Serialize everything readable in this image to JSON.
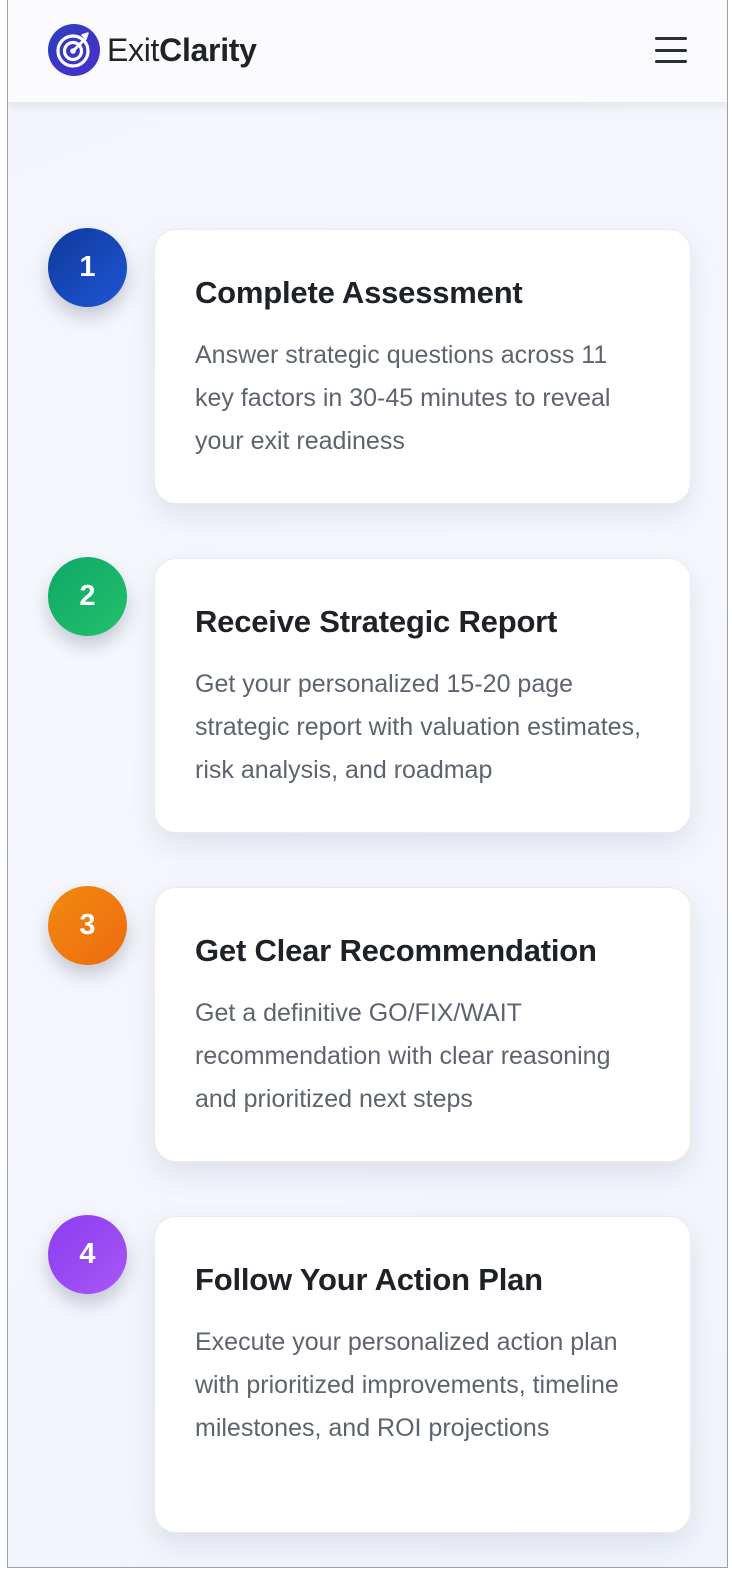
{
  "header": {
    "brand_part1": "Exit",
    "brand_part2": "Clarity",
    "logo_icon": "target-arrow-icon",
    "menu_icon": "hamburger-menu-icon"
  },
  "steps": [
    {
      "number": "1",
      "title": "Complete Assessment",
      "description": "Answer strategic questions across 11 key factors in 30-45 minutes to reveal your exit readiness",
      "color": "#1746c2"
    },
    {
      "number": "2",
      "title": "Receive Strategic Report",
      "description": "Get your personalized 15-20 page strategic report with valuation estimates, risk analysis, and roadmap",
      "color": "#16b167"
    },
    {
      "number": "3",
      "title": "Get Clear Recommendation",
      "description": "Get a definitive GO/FIX/WAIT recommendation with clear reasoning and prioritized next steps",
      "color": "#f07a10"
    },
    {
      "number": "4",
      "title": "Follow Your Action Plan",
      "description": "Execute your personalized action plan with prioritized improvements, timeline milestones, and ROI projections",
      "color": "#9a49f3"
    }
  ]
}
